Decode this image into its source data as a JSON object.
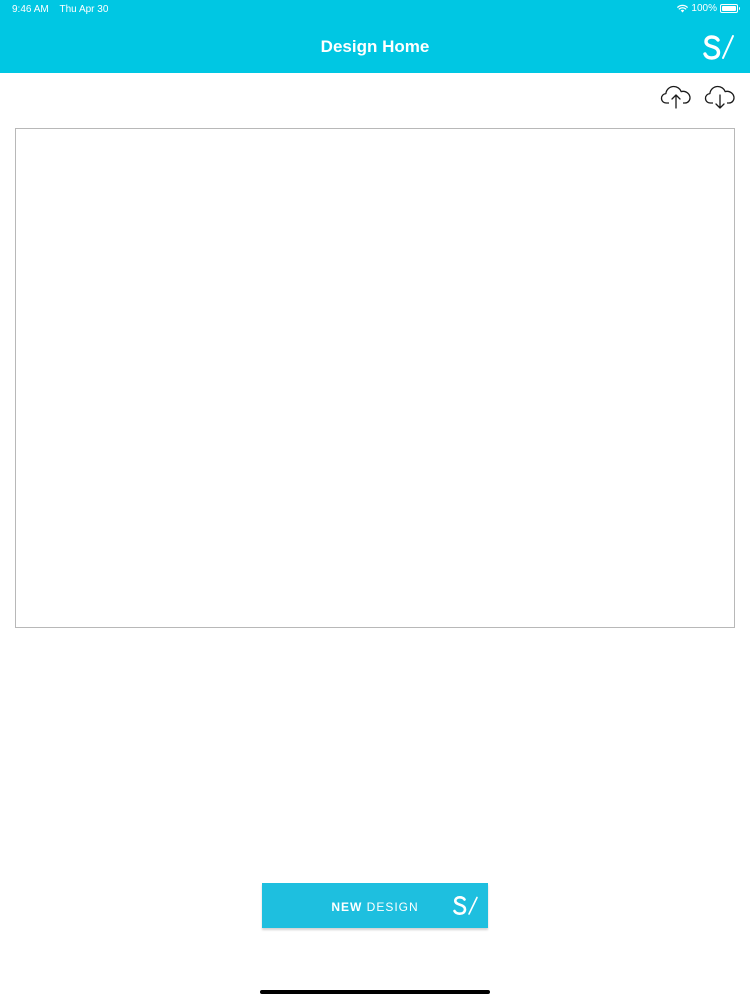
{
  "status_bar": {
    "time": "9:46 AM",
    "date": "Thu Apr 30",
    "battery_text": "100%",
    "battery_level": 1.0,
    "wifi_icon": "wifi-icon",
    "battery_icon": "battery-icon"
  },
  "header": {
    "title": "Design Home",
    "logo_icon": "s-slash-logo-icon",
    "background_color": "#00c7e3"
  },
  "toolbar": {
    "upload_icon": "cloud-upload-icon",
    "download_icon": "cloud-download-icon"
  },
  "new_design_button": {
    "label_bold": "NEW",
    "label_light": "DESIGN",
    "logo_icon": "s-slash-logo-icon",
    "background_color": "#1ebfdf"
  }
}
